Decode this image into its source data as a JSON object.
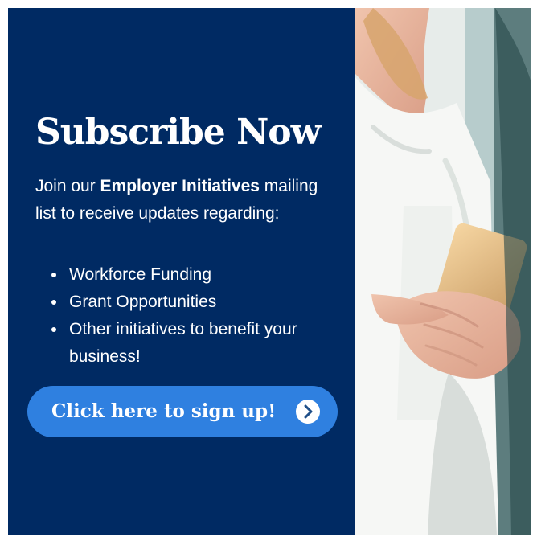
{
  "headline": "Subscribe Now",
  "intro": {
    "prefix": "Join our ",
    "emphasis": "Employer Initiatives",
    "suffix": " mailing list to receive updates regarding:"
  },
  "bullets": [
    "Workforce Funding",
    "Grant Opportunities",
    "Other initiatives to benefit your business!"
  ],
  "cta": {
    "label": "Click here to sign up!",
    "icon": "chevron-right-icon"
  },
  "colors": {
    "panel": "#002a63",
    "button": "#2f80e0",
    "text": "#ffffff"
  }
}
